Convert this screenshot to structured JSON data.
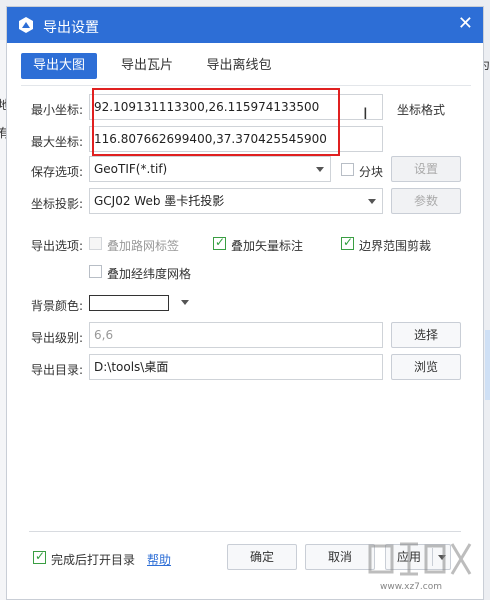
{
  "background": {
    "left_chars": [
      "地",
      "有"
    ],
    "right_char": "为"
  },
  "dialog": {
    "title": "导出设置",
    "close_glyph": "✕"
  },
  "tabs": [
    {
      "label": "导出大图",
      "active": true
    },
    {
      "label": "导出瓦片",
      "active": false
    },
    {
      "label": "导出离线包",
      "active": false
    }
  ],
  "form": {
    "min_coord": {
      "label": "最小坐标:",
      "value": "92.109131113300,26.115974133500"
    },
    "max_coord": {
      "label": "最大坐标:",
      "value": "116.807662699400,37.370425545900"
    },
    "coord_format_label": "坐标格式",
    "save_option": {
      "label": "保存选项:",
      "value": "GeoTIF(*.tif)"
    },
    "tile_checkbox": {
      "label": "分块",
      "checked": false
    },
    "settings_button": "设置",
    "projection": {
      "label": "坐标投影:",
      "value": "GCJ02 Web 墨卡托投影"
    },
    "params_button": "参数",
    "export_options_label": "导出选项:",
    "options": [
      {
        "label": "叠加路网标签",
        "checked": false,
        "disabled": true
      },
      {
        "label": "叠加矢量标注",
        "checked": true,
        "disabled": false
      },
      {
        "label": "边界范围剪裁",
        "checked": true,
        "disabled": false
      },
      {
        "label": "叠加经纬度网格",
        "checked": false,
        "disabled": false
      }
    ],
    "bg_color": {
      "label": "背景颜色:",
      "value": "#ffffff"
    },
    "export_level": {
      "label": "导出级别:",
      "value": "6,6"
    },
    "select_button": "选择",
    "export_dir": {
      "label": "导出目录:",
      "value": "D:\\tools\\桌面"
    },
    "browse_button": "浏览"
  },
  "footer": {
    "open_dir_checkbox": {
      "label": "完成后打开目录",
      "checked": true
    },
    "help_link": "帮助",
    "ok_button": "确定",
    "cancel_button": "取消",
    "apply_button": "应用"
  },
  "watermark": {
    "sub_text": "www.xz7.com"
  },
  "colors": {
    "accent": "#2d6ed6",
    "highlight": "#e02020",
    "check": "#2f9e3c"
  }
}
